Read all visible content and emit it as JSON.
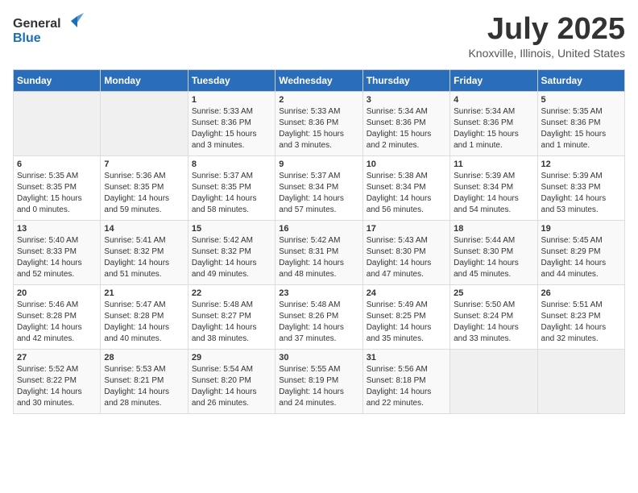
{
  "header": {
    "logo_general": "General",
    "logo_blue": "Blue",
    "title": "July 2025",
    "subtitle": "Knoxville, Illinois, United States"
  },
  "calendar": {
    "days_of_week": [
      "Sunday",
      "Monday",
      "Tuesday",
      "Wednesday",
      "Thursday",
      "Friday",
      "Saturday"
    ],
    "weeks": [
      [
        {
          "day": "",
          "sunrise": "",
          "sunset": "",
          "daylight": "",
          "empty": true
        },
        {
          "day": "",
          "sunrise": "",
          "sunset": "",
          "daylight": "",
          "empty": true
        },
        {
          "day": "1",
          "sunrise": "Sunrise: 5:33 AM",
          "sunset": "Sunset: 8:36 PM",
          "daylight": "Daylight: 15 hours and 3 minutes.",
          "empty": false
        },
        {
          "day": "2",
          "sunrise": "Sunrise: 5:33 AM",
          "sunset": "Sunset: 8:36 PM",
          "daylight": "Daylight: 15 hours and 3 minutes.",
          "empty": false
        },
        {
          "day": "3",
          "sunrise": "Sunrise: 5:34 AM",
          "sunset": "Sunset: 8:36 PM",
          "daylight": "Daylight: 15 hours and 2 minutes.",
          "empty": false
        },
        {
          "day": "4",
          "sunrise": "Sunrise: 5:34 AM",
          "sunset": "Sunset: 8:36 PM",
          "daylight": "Daylight: 15 hours and 1 minute.",
          "empty": false
        },
        {
          "day": "5",
          "sunrise": "Sunrise: 5:35 AM",
          "sunset": "Sunset: 8:36 PM",
          "daylight": "Daylight: 15 hours and 1 minute.",
          "empty": false
        }
      ],
      [
        {
          "day": "6",
          "sunrise": "Sunrise: 5:35 AM",
          "sunset": "Sunset: 8:35 PM",
          "daylight": "Daylight: 15 hours and 0 minutes.",
          "empty": false
        },
        {
          "day": "7",
          "sunrise": "Sunrise: 5:36 AM",
          "sunset": "Sunset: 8:35 PM",
          "daylight": "Daylight: 14 hours and 59 minutes.",
          "empty": false
        },
        {
          "day": "8",
          "sunrise": "Sunrise: 5:37 AM",
          "sunset": "Sunset: 8:35 PM",
          "daylight": "Daylight: 14 hours and 58 minutes.",
          "empty": false
        },
        {
          "day": "9",
          "sunrise": "Sunrise: 5:37 AM",
          "sunset": "Sunset: 8:34 PM",
          "daylight": "Daylight: 14 hours and 57 minutes.",
          "empty": false
        },
        {
          "day": "10",
          "sunrise": "Sunrise: 5:38 AM",
          "sunset": "Sunset: 8:34 PM",
          "daylight": "Daylight: 14 hours and 56 minutes.",
          "empty": false
        },
        {
          "day": "11",
          "sunrise": "Sunrise: 5:39 AM",
          "sunset": "Sunset: 8:34 PM",
          "daylight": "Daylight: 14 hours and 54 minutes.",
          "empty": false
        },
        {
          "day": "12",
          "sunrise": "Sunrise: 5:39 AM",
          "sunset": "Sunset: 8:33 PM",
          "daylight": "Daylight: 14 hours and 53 minutes.",
          "empty": false
        }
      ],
      [
        {
          "day": "13",
          "sunrise": "Sunrise: 5:40 AM",
          "sunset": "Sunset: 8:33 PM",
          "daylight": "Daylight: 14 hours and 52 minutes.",
          "empty": false
        },
        {
          "day": "14",
          "sunrise": "Sunrise: 5:41 AM",
          "sunset": "Sunset: 8:32 PM",
          "daylight": "Daylight: 14 hours and 51 minutes.",
          "empty": false
        },
        {
          "day": "15",
          "sunrise": "Sunrise: 5:42 AM",
          "sunset": "Sunset: 8:32 PM",
          "daylight": "Daylight: 14 hours and 49 minutes.",
          "empty": false
        },
        {
          "day": "16",
          "sunrise": "Sunrise: 5:42 AM",
          "sunset": "Sunset: 8:31 PM",
          "daylight": "Daylight: 14 hours and 48 minutes.",
          "empty": false
        },
        {
          "day": "17",
          "sunrise": "Sunrise: 5:43 AM",
          "sunset": "Sunset: 8:30 PM",
          "daylight": "Daylight: 14 hours and 47 minutes.",
          "empty": false
        },
        {
          "day": "18",
          "sunrise": "Sunrise: 5:44 AM",
          "sunset": "Sunset: 8:30 PM",
          "daylight": "Daylight: 14 hours and 45 minutes.",
          "empty": false
        },
        {
          "day": "19",
          "sunrise": "Sunrise: 5:45 AM",
          "sunset": "Sunset: 8:29 PM",
          "daylight": "Daylight: 14 hours and 44 minutes.",
          "empty": false
        }
      ],
      [
        {
          "day": "20",
          "sunrise": "Sunrise: 5:46 AM",
          "sunset": "Sunset: 8:28 PM",
          "daylight": "Daylight: 14 hours and 42 minutes.",
          "empty": false
        },
        {
          "day": "21",
          "sunrise": "Sunrise: 5:47 AM",
          "sunset": "Sunset: 8:28 PM",
          "daylight": "Daylight: 14 hours and 40 minutes.",
          "empty": false
        },
        {
          "day": "22",
          "sunrise": "Sunrise: 5:48 AM",
          "sunset": "Sunset: 8:27 PM",
          "daylight": "Daylight: 14 hours and 38 minutes.",
          "empty": false
        },
        {
          "day": "23",
          "sunrise": "Sunrise: 5:48 AM",
          "sunset": "Sunset: 8:26 PM",
          "daylight": "Daylight: 14 hours and 37 minutes.",
          "empty": false
        },
        {
          "day": "24",
          "sunrise": "Sunrise: 5:49 AM",
          "sunset": "Sunset: 8:25 PM",
          "daylight": "Daylight: 14 hours and 35 minutes.",
          "empty": false
        },
        {
          "day": "25",
          "sunrise": "Sunrise: 5:50 AM",
          "sunset": "Sunset: 8:24 PM",
          "daylight": "Daylight: 14 hours and 33 minutes.",
          "empty": false
        },
        {
          "day": "26",
          "sunrise": "Sunrise: 5:51 AM",
          "sunset": "Sunset: 8:23 PM",
          "daylight": "Daylight: 14 hours and 32 minutes.",
          "empty": false
        }
      ],
      [
        {
          "day": "27",
          "sunrise": "Sunrise: 5:52 AM",
          "sunset": "Sunset: 8:22 PM",
          "daylight": "Daylight: 14 hours and 30 minutes.",
          "empty": false
        },
        {
          "day": "28",
          "sunrise": "Sunrise: 5:53 AM",
          "sunset": "Sunset: 8:21 PM",
          "daylight": "Daylight: 14 hours and 28 minutes.",
          "empty": false
        },
        {
          "day": "29",
          "sunrise": "Sunrise: 5:54 AM",
          "sunset": "Sunset: 8:20 PM",
          "daylight": "Daylight: 14 hours and 26 minutes.",
          "empty": false
        },
        {
          "day": "30",
          "sunrise": "Sunrise: 5:55 AM",
          "sunset": "Sunset: 8:19 PM",
          "daylight": "Daylight: 14 hours and 24 minutes.",
          "empty": false
        },
        {
          "day": "31",
          "sunrise": "Sunrise: 5:56 AM",
          "sunset": "Sunset: 8:18 PM",
          "daylight": "Daylight: 14 hours and 22 minutes.",
          "empty": false
        },
        {
          "day": "",
          "sunrise": "",
          "sunset": "",
          "daylight": "",
          "empty": true
        },
        {
          "day": "",
          "sunrise": "",
          "sunset": "",
          "daylight": "",
          "empty": true
        }
      ]
    ]
  }
}
